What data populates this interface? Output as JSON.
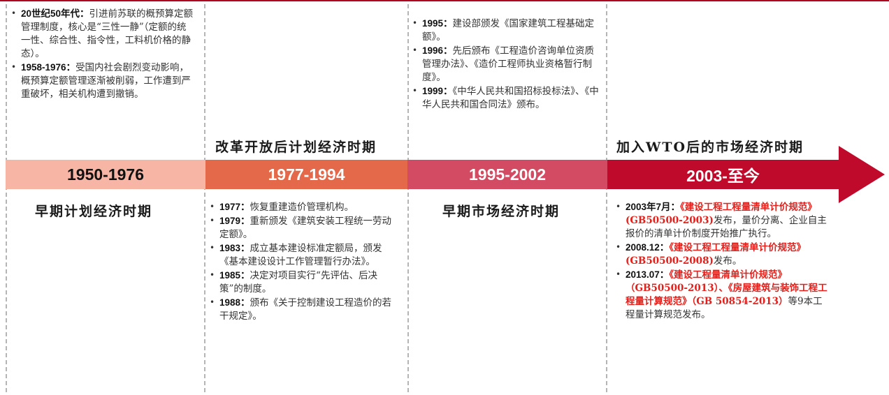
{
  "periods": [
    {
      "years": "1950-1976",
      "era": "早期计划经济时期"
    },
    {
      "years": "1977-1994",
      "era": "改革开放后计划经济时期"
    },
    {
      "years": "1995-2002",
      "era": "早期市场经济时期"
    },
    {
      "years": "2003-至今",
      "era": "加入WTO后的市场经济时期"
    }
  ],
  "colors": {
    "band1": "#f7b5a5",
    "band2": "#e4694a",
    "band3": "#d24b62",
    "band4": "#bf0a2b",
    "rule": "#b00020",
    "highlight": "#e3201b"
  },
  "col1": [
    {
      "year": "20世纪50年代：",
      "text": "引进前苏联的概预算定额管理制度，核心是“三性一静”（定额的统一性、综合性、指令性，工料机价格的静态）。"
    },
    {
      "year": "1958-1976：",
      "text": "受国内社会剧烈变动影响，概预算定额管理逐渐被削弱，工作遭到严重破坏，相关机构遭到撤销。"
    }
  ],
  "col2": [
    {
      "year": "1977：",
      "text": "恢复重建造价管理机构。"
    },
    {
      "year": "1979：",
      "text": "重新颁发《建筑安装工程统一劳动定额》。"
    },
    {
      "year": "1983：",
      "text": "成立基本建设标准定额局，颁发《基本建设设计工作管理暂行办法》。"
    },
    {
      "year": "1985：",
      "text": "决定对项目实行“先评估、后决策”的制度。"
    },
    {
      "year": "1988：",
      "text": "颁布《关于控制建设工程造价的若干规定》。"
    }
  ],
  "col3": [
    {
      "year": "1995：",
      "text": "建设部颁发《国家建筑工程基础定额》。"
    },
    {
      "year": "1996：",
      "text": "先后颁布《工程造价咨询单位资质管理办法》、《造价工程师执业资格暂行制度》。"
    },
    {
      "year": "1999：",
      "text": "《中华人民共和国招标投标法》、《中华人民共和国合同法》颁布。"
    }
  ],
  "col4": [
    {
      "year": "2003年7月：",
      "red": "《建设工程工程量清单计价规范》(GB50500-2003)",
      "text": "发布，量价分离、企业自主报价的清单计价制度开始推广执行。"
    },
    {
      "year": "2008.12：",
      "red": "《建设工程工程量清单计价规范》(GB50500-2008)",
      "text": "发布。"
    },
    {
      "year": "2013.07：",
      "red": "《建设工程量清单计价规范》（GB50500-2013）、《房屋建筑与装饰工程工程量计算规范》（GB 50854-2013）",
      "text": "等9本工程量计算规范发布。"
    }
  ]
}
